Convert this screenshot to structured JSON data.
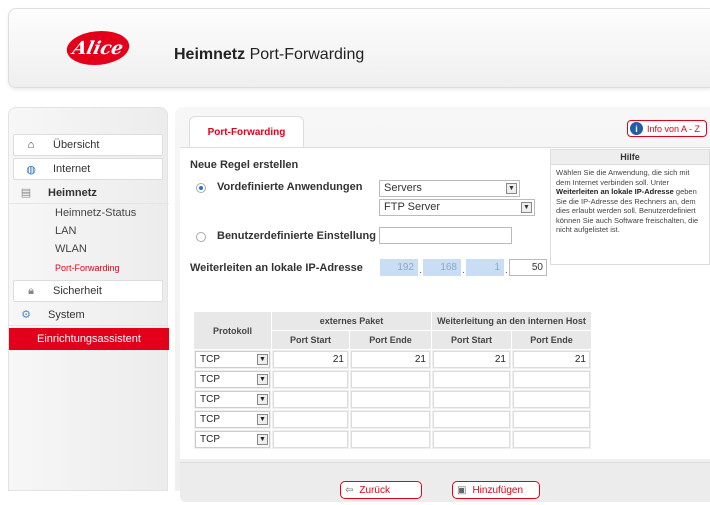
{
  "header": {
    "logo_text": "Alice",
    "title_bold": "Heimnetz",
    "title_rest": " Port-Forwarding"
  },
  "sidebar": {
    "items": [
      {
        "label": "Übersicht",
        "icon": "house-icon"
      },
      {
        "label": "Internet",
        "icon": "globe-icon"
      },
      {
        "label": "Heimnetz",
        "icon": "network-icon"
      },
      {
        "label": "Sicherheit",
        "icon": "lock-icon"
      },
      {
        "label": "System",
        "icon": "gear-icon"
      }
    ],
    "sub_items": [
      "Heimnetz-Status",
      "LAN",
      "WLAN",
      "Port-Forwarding"
    ],
    "wizard": "Einrichtungsassistent"
  },
  "tab": {
    "label": "Port-Forwarding"
  },
  "info_button": "Info von A - Z",
  "form": {
    "heading": "Neue Regel erstellen",
    "predefined_label": "Vordefinierte Anwendungen",
    "category_value": "Servers",
    "app_value": "FTP Server",
    "custom_label": "Benutzerdefinierte Einstellung",
    "custom_value": "",
    "forward_label": "Weiterleiten an lokale IP-Adresse",
    "ip": [
      "192",
      "168",
      "1",
      "50"
    ]
  },
  "help": {
    "title": "Hilfe",
    "text1": "Wählen Sie die Anwendung, die sich mit dem Internet verbinden soll. Unter ",
    "text_bold": "Weiterleiten an lokale IP-Adresse",
    "text2": " geben Sie die IP-Adresse des Rechners an, dem dies erlaubt werden soll. Benutzerdefiniert können Sie auch Software freischalten, die nicht aufgelistet ist."
  },
  "table": {
    "protocol_header": "Protokoll",
    "external_header": "externes Paket",
    "internal_header": "Weiterleitung an den internen Host",
    "port_start": "Port Start",
    "port_end": "Port Ende",
    "rows": [
      {
        "protocol": "TCP",
        "ext_start": "21",
        "ext_end": "21",
        "int_start": "21",
        "int_end": "21"
      },
      {
        "protocol": "TCP",
        "ext_start": "",
        "ext_end": "",
        "int_start": "",
        "int_end": ""
      },
      {
        "protocol": "TCP",
        "ext_start": "",
        "ext_end": "",
        "int_start": "",
        "int_end": ""
      },
      {
        "protocol": "TCP",
        "ext_start": "",
        "ext_end": "",
        "int_start": "",
        "int_end": ""
      },
      {
        "protocol": "TCP",
        "ext_start": "",
        "ext_end": "",
        "int_start": "",
        "int_end": ""
      }
    ]
  },
  "footer": {
    "back": "Zurück",
    "add": "Hinzufügen"
  },
  "colors": {
    "brand_red": "#e2001a",
    "radio_blue": "#2a72c7",
    "ip_fill": "#c9ddf4"
  }
}
